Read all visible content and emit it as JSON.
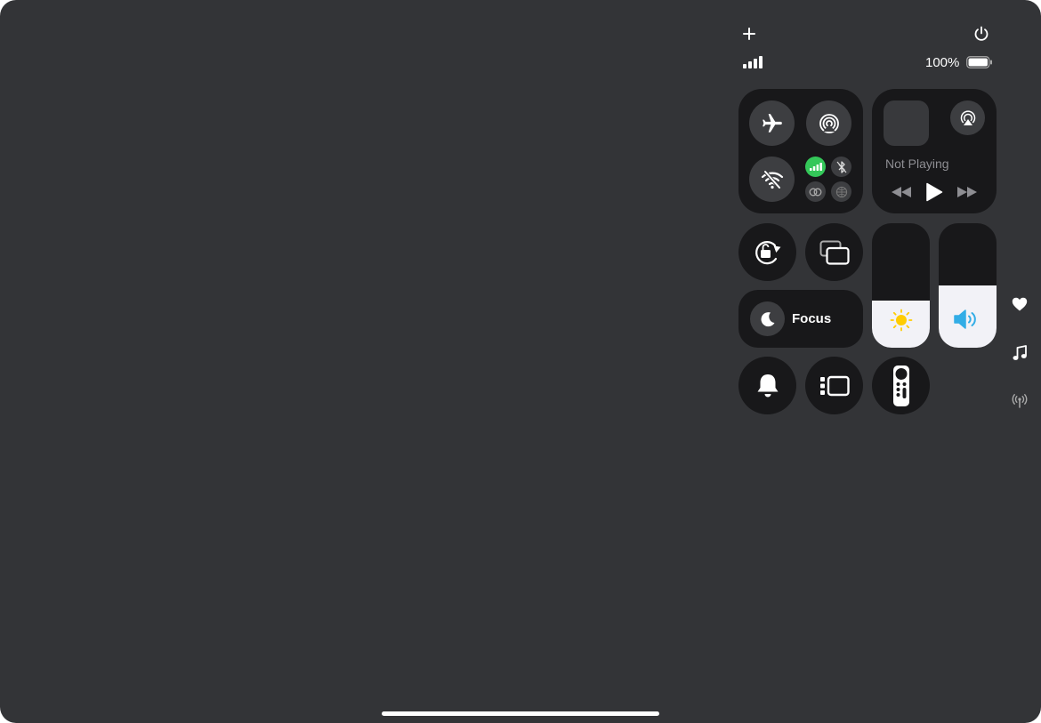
{
  "status": {
    "battery_percent": "100%",
    "battery_level": 1.0,
    "signal_bars": 4
  },
  "connectivity": {
    "airplane_mode": false,
    "airdrop": false,
    "wifi": false,
    "cellular": true,
    "bluetooth": false,
    "cellular_color": "#34c759"
  },
  "now_playing": {
    "label": "Not Playing"
  },
  "focus": {
    "label": "Focus"
  },
  "sliders": {
    "brightness_level": 0.38,
    "volume_level": 0.5,
    "brightness_icon_color": "#ffcc00",
    "volume_icon_color": "#32ade6"
  },
  "side_icons": [
    "heart-icon",
    "music-note-icon",
    "antenna-icon"
  ]
}
